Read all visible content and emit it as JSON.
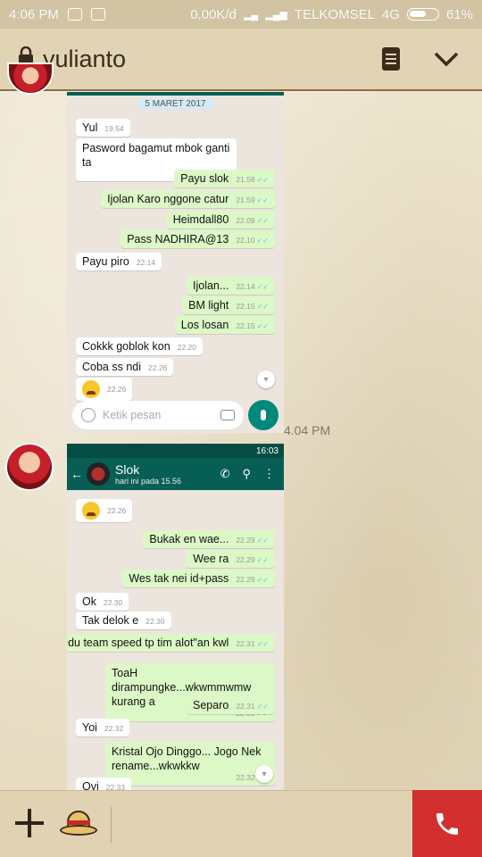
{
  "status_bar": {
    "time": "4:06 PM",
    "speed": "0,00K/d",
    "carrier": "TELKOMSEL",
    "network": "4G",
    "battery": "61%",
    "battery_level": 0.61
  },
  "header": {
    "title": "yulianto"
  },
  "message1": {
    "timestamp": "4.04 PM",
    "screenshot": {
      "date_chip": "5 MARET 2017",
      "messages": [
        {
          "dir": "in",
          "text": "Yul",
          "time": "19.54"
        },
        {
          "dir": "in",
          "text": "Pasword bagamut mbok ganti ta",
          "time": "19.54"
        },
        {
          "dir": "out",
          "text": "Payu slok",
          "time": "21.58"
        },
        {
          "dir": "out",
          "text": "Ijolan Karo nggone catur",
          "time": "21.59"
        },
        {
          "dir": "out",
          "text": "Heimdall80",
          "time": "22.09"
        },
        {
          "dir": "out",
          "text": "Pass NADHIRA@13",
          "time": "22.10"
        },
        {
          "dir": "in",
          "text": "Payu piro",
          "time": "22.14"
        },
        {
          "dir": "out",
          "text": "Ijolan...",
          "time": "22.14"
        },
        {
          "dir": "out",
          "text": "BM light",
          "time": "22.15"
        },
        {
          "dir": "out",
          "text": "Los losan",
          "time": "22.15"
        },
        {
          "dir": "in",
          "text": "Cokkk goblok kon",
          "time": "22.20"
        },
        {
          "dir": "in",
          "text": "Coba ss ndi",
          "time": "22.26"
        },
        {
          "dir": "in",
          "text": "",
          "time": "22.26",
          "emoji": "weary-face"
        }
      ],
      "input_placeholder": "Ketik pesan"
    }
  },
  "message2": {
    "screenshot": {
      "status_time": "16:03",
      "contact_name": "Slok",
      "last_seen": "hari ini pada 15.56",
      "messages": [
        {
          "dir": "in",
          "text": "",
          "time": "22.26",
          "emoji": "weary-face"
        },
        {
          "dir": "out",
          "text": "Bukak en wae...",
          "time": "22.29"
        },
        {
          "dir": "out",
          "text": "Wee ra",
          "time": "22.29"
        },
        {
          "dir": "out",
          "text": "Wes tak nei id+pass",
          "time": "22.29"
        },
        {
          "dir": "in",
          "text": "Ok",
          "time": "22.30"
        },
        {
          "dir": "in",
          "text": "Tak delok e",
          "time": "22.30"
        },
        {
          "dir": "out",
          "text": "Udu team speed tp tim alot\"an kwl",
          "time": "22.31"
        },
        {
          "dir": "out",
          "text": "ToaH dirampungke...wkwmmwmw kurang a",
          "time": "22.31"
        },
        {
          "dir": "out",
          "text": "Separo",
          "time": "22.31"
        },
        {
          "dir": "in",
          "text": "Yoi",
          "time": "22.32"
        },
        {
          "dir": "out",
          "text": "Kristal Ojo Dinggo... Jogo Nek rename...wkwkkw",
          "time": "22.32"
        },
        {
          "dir": "in",
          "text": "Ovi",
          "time": "22.33"
        }
      ]
    }
  },
  "colors": {
    "parchment": "#e9dfc7",
    "wa_green": "#075e54",
    "bubble_out": "#dcf8c6",
    "call_red": "#d32f2f"
  },
  "icons": [
    "lock-icon",
    "document-icon",
    "chevron-down-icon",
    "plus-icon",
    "straw-hat-icon",
    "phone-icon",
    "mic-icon",
    "camera-icon",
    "smiley-icon"
  ]
}
